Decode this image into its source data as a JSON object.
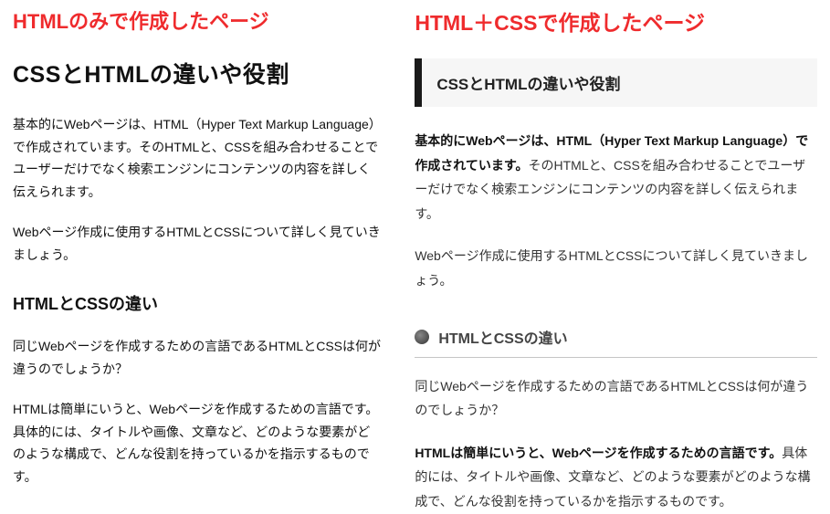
{
  "left": {
    "header": "HTMLのみで作成したページ",
    "mainHeading": "CSSとHTMLの違いや役割",
    "para1": "基本的にWebページは、HTML（Hyper Text Markup Language）で作成されています。そのHTMLと、CSSを組み合わせることでユーザーだけでなく検索エンジンにコンテンツの内容を詳しく伝えられます。",
    "para2": "Webページ作成に使用するHTMLとCSSについて詳しく見ていきましょう。",
    "subHeading": "HTMLとCSSの違い",
    "para3": "同じWebページを作成するための言語であるHTMLとCSSは何が違うのでしょうか？",
    "para4": "HTMLは簡単にいうと、Webページを作成するための言語です。具体的には、タイトルや画像、文章など、どのような要素がどのような構成で、どんな役割を持っているかを指示するものです。"
  },
  "right": {
    "header": "HTML＋CSSで作成したページ",
    "boxHeading": "CSSとHTMLの違いや役割",
    "para1Bold": "基本的にWebページは、HTML（Hyper Text Markup Language）で作成されています。",
    "para1Rest": "そのHTMLと、CSSを組み合わせることでユーザーだけでなく検索エンジンにコンテンツの内容を詳しく伝えられます。",
    "para2": "Webページ作成に使用するHTMLとCSSについて詳しく見ていきましょう。",
    "subHeading": "HTMLとCSSの違い",
    "para3": "同じWebページを作成するための言語であるHTMLとCSSは何が違うのでしょうか？",
    "para4Bold": "HTMLは簡単にいうと、Webページを作成するための言語です。",
    "para4Rest": "具体的には、タイトルや画像、文章など、どのような要素がどのような構成で、どんな役割を持っているかを指示するものです。"
  }
}
